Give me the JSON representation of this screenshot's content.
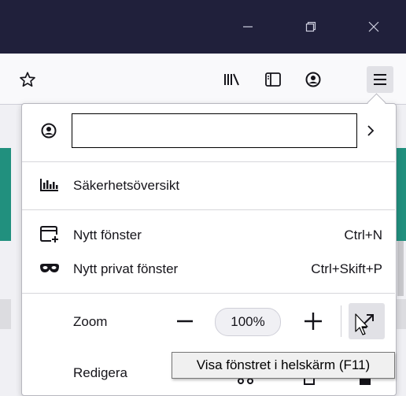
{
  "titlebar": {
    "minimize_icon": "minimize-icon",
    "restore_icon": "restore-icon",
    "close_icon": "close-icon"
  },
  "toolbar": {
    "bookmark_star_icon": "star-icon",
    "library_icon": "library-icon",
    "sidebar_icon": "sidebar-icon",
    "account_icon": "account-icon",
    "menu_icon": "hamburger-menu-icon"
  },
  "menu": {
    "account": {
      "value": "",
      "chevron": "›"
    },
    "security_overview": "Säkerhetsöversikt",
    "new_window": {
      "label": "Nytt fönster",
      "shortcut": "Ctrl+N"
    },
    "new_private_window": {
      "label": "Nytt privat fönster",
      "shortcut": "Ctrl+Skift+P"
    },
    "zoom": {
      "label": "Zoom",
      "minus": "−",
      "level": "100%",
      "plus": "+"
    },
    "edit": {
      "label": "Redigera"
    }
  },
  "tooltip": "Visa fönstret i helskärm (F11)",
  "colors": {
    "titlebar": "#20203b",
    "toolbar": "#f9f9fb",
    "page_accent": "#21907e"
  }
}
